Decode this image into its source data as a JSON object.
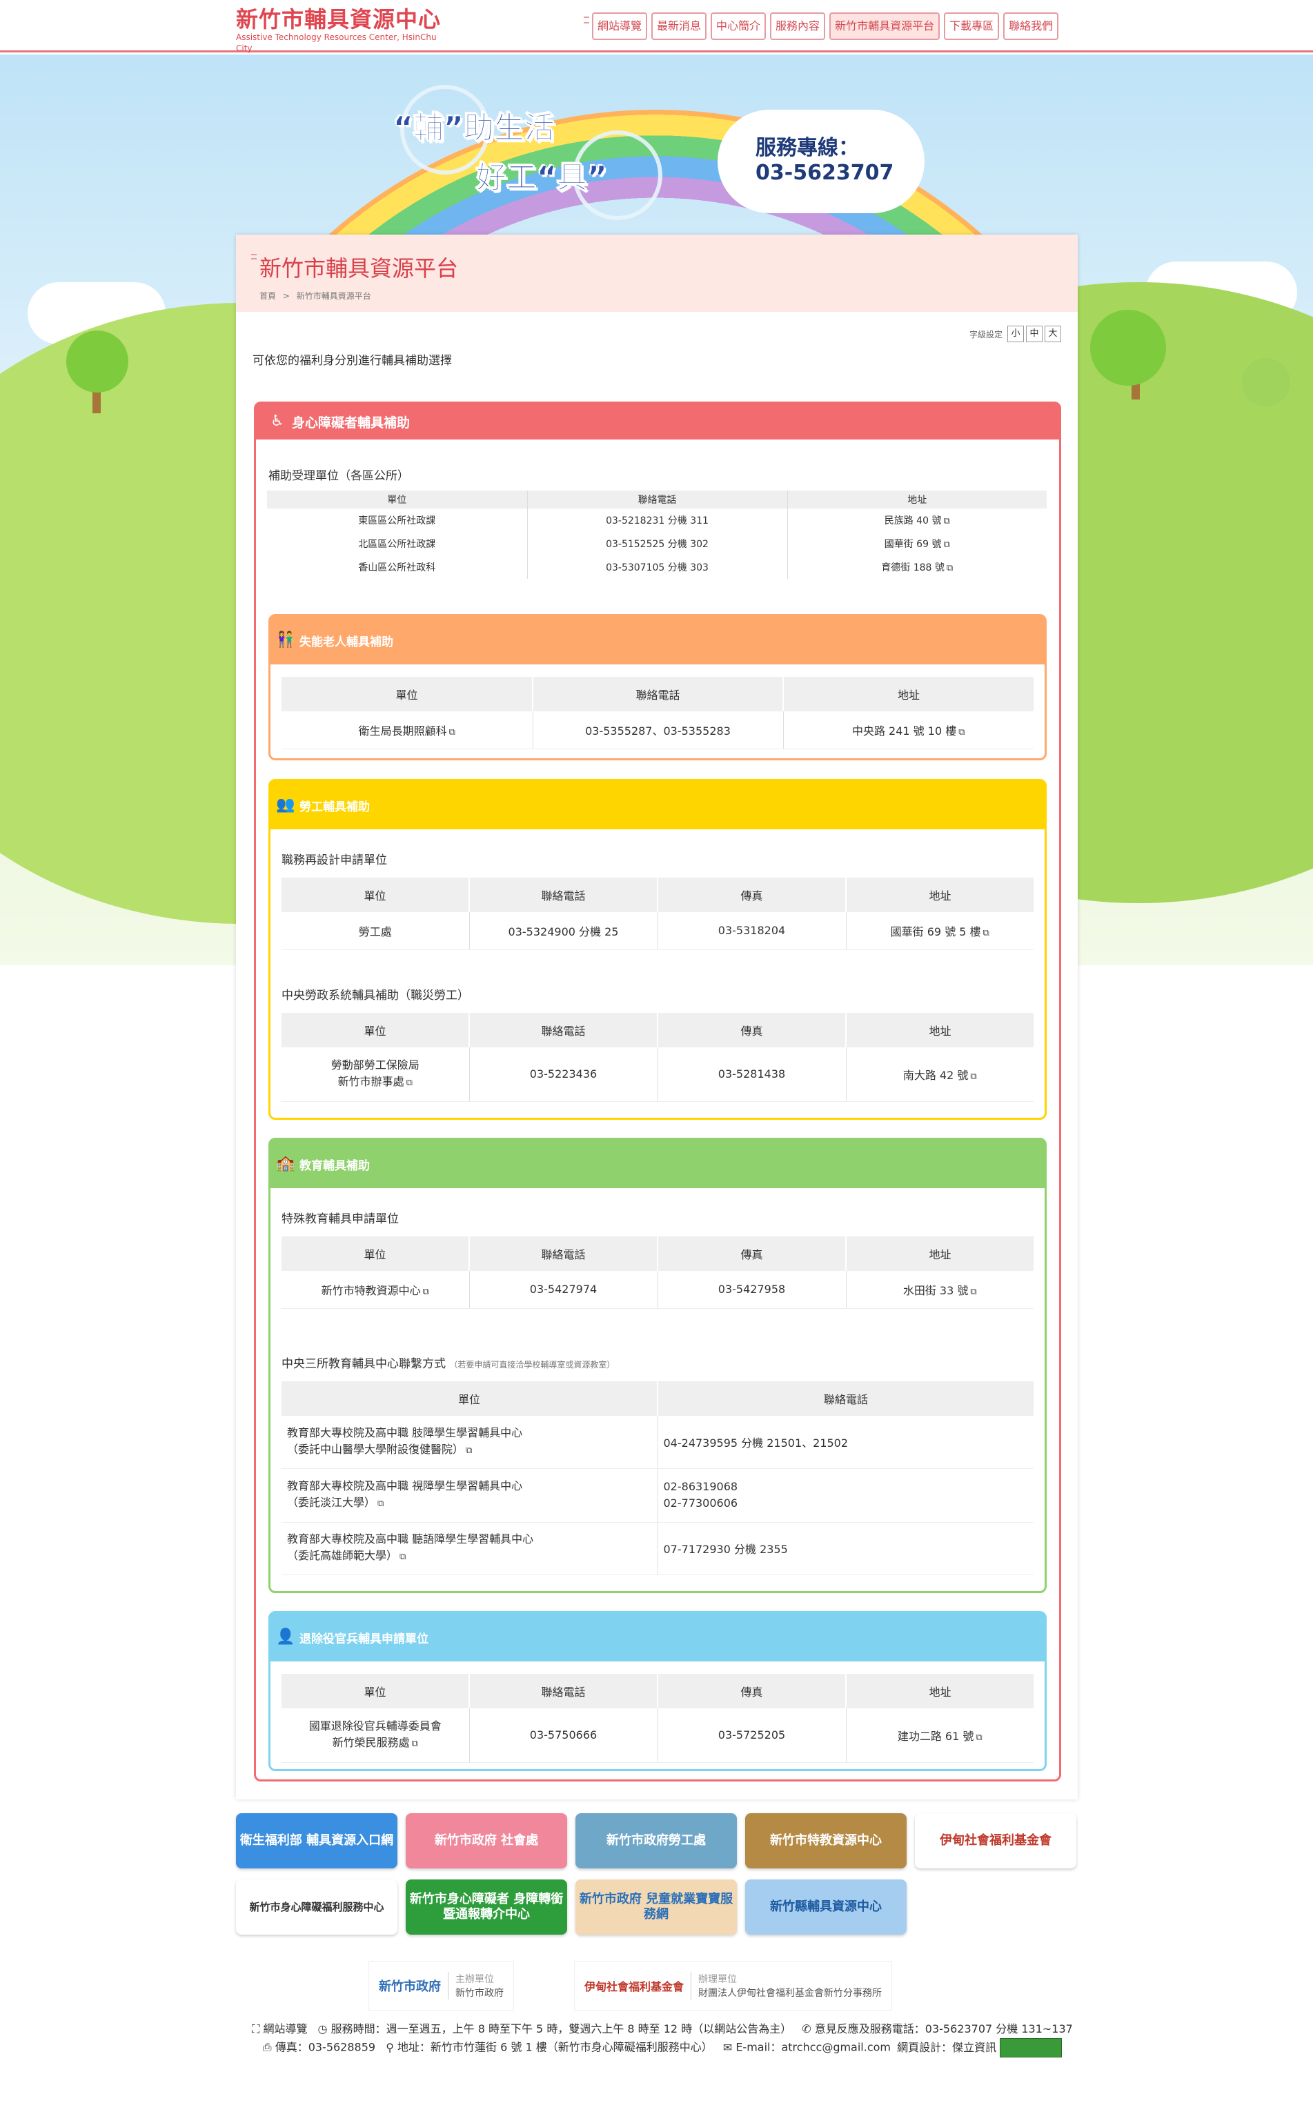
{
  "header": {
    "logo_title": "新竹市輔具資源中心",
    "logo_subtitle": "Assistive Technology Resources Center, HsinChu City",
    "nav": [
      "網站導覽",
      "最新消息",
      "中心簡介",
      "服務內容",
      "新竹市輔具資源平台",
      "下載專區",
      "聯絡我們"
    ]
  },
  "hero": {
    "slogan_line1": "“輔”助生活",
    "slogan_line2": "好工“具”",
    "hotline_label": "服務專線：",
    "hotline_number": "03-5623707"
  },
  "page": {
    "title": "新竹市輔具資源平台",
    "breadcrumb_home": "首頁",
    "breadcrumb_sep": ">",
    "breadcrumb_current": "新竹市輔具資源平台",
    "font_size_label": "字級設定",
    "font_sizes": [
      "小",
      "中",
      "大"
    ],
    "intro": "可依您的福利身分別進行輔具補助選擇"
  },
  "disabled": {
    "heading": "身心障礙者輔具補助",
    "sub_label": "補助受理單位（各區公所）",
    "columns": [
      "單位",
      "聯絡電話",
      "地址"
    ],
    "rows": [
      [
        "東區區公所社政課",
        "03-5218231 分機 311",
        "民族路 40 號"
      ],
      [
        "北區區公所社政課",
        "03-5152525 分機 302",
        "國華街 69 號"
      ],
      [
        "香山區公所社政科",
        "03-5307105 分機 303",
        "育德街 188 號"
      ]
    ]
  },
  "elderly": {
    "heading": "失能老人輔具補助",
    "columns": [
      "單位",
      "聯絡電話",
      "地址"
    ],
    "row": [
      "衛生局長期照顧科",
      "03-5355287、03-5355283",
      "中央路 241 號 10 樓"
    ]
  },
  "labor": {
    "heading": "勞工輔具補助",
    "sub1_label": "職務再設計申請單位",
    "columns": [
      "單位",
      "聯絡電話",
      "傳真",
      "地址"
    ],
    "sub1_row": [
      "勞工處",
      "03-5324900 分機 25",
      "03-5318204",
      "國華街 69 號 5 樓"
    ],
    "sub2_label": "中央勞政系統輔具補助（職災勞工）",
    "sub2_row_unit1": "勞動部勞工保險局",
    "sub2_row_unit2": "新竹市辦事處",
    "sub2_row": [
      "03-5223436",
      "03-5281438",
      "南大路 42 號"
    ]
  },
  "education": {
    "heading": "教育輔具補助",
    "sub1_label": "特殊教育輔具申請單位",
    "columns": [
      "單位",
      "聯絡電話",
      "傳真",
      "地址"
    ],
    "sub1_row": [
      "新竹市特教資源中心",
      "03-5427974",
      "03-5427958",
      "水田街 33 號"
    ],
    "sub2_label": "中央三所教育輔具中心聯繫方式",
    "sub2_note": "（若要申請可直接洽學校輔導室或資源教室）",
    "sub2_columns": [
      "單位",
      "聯絡電話"
    ],
    "sub2_rows": [
      {
        "unit1": "教育部大專校院及高中職 肢障學生學習輔具中心",
        "unit2": "（委託中山醫學大學附設復健醫院）",
        "phone1": "04-24739595 分機 21501、21502",
        "phone2": ""
      },
      {
        "unit1": "教育部大專校院及高中職 視障學生學習輔具中心",
        "unit2": "（委託淡江大學）",
        "phone1": "02-86319068",
        "phone2": "02-77300606"
      },
      {
        "unit1": "教育部大專校院及高中職 聽語障學生學習輔具中心",
        "unit2": "（委託高雄師範大學）",
        "phone1": "07-7172930 分機 2355",
        "phone2": ""
      }
    ]
  },
  "veteran": {
    "heading": "退除役官兵輔具申請單位",
    "columns": [
      "單位",
      "聯絡電話",
      "傳真",
      "地址"
    ],
    "unit1": "國軍退除役官兵輔導委員會",
    "unit2": "新竹榮民服務處",
    "row": [
      "03-5750666",
      "03-5725205",
      "建功二路 61 號"
    ]
  },
  "links": {
    "banners": [
      {
        "text": "衛生福利部 輔具資源入口網",
        "color": "#3a8fe0"
      },
      {
        "text": "新竹市政府 社會處",
        "color": "#f0879a"
      },
      {
        "text": "新竹市政府勞工處",
        "color": "#6fa7c9"
      },
      {
        "text": "新竹市特教資源中心",
        "color": "#b48a45"
      },
      {
        "text": "伊甸社會福利基金會",
        "color": "#ffffff"
      },
      {
        "text": "新竹市身心障礙福利服務中心",
        "color": "#ffffff"
      },
      {
        "text": "新竹市身心障礙者 身障轉銜暨通報轉介中心",
        "color": "#2e9e3d"
      },
      {
        "text": "新竹市政府 兒童就業寶寶服務網",
        "color": "#f3d9b3"
      },
      {
        "text": "新竹縣輔具資源中心",
        "color": "#a4cdf0"
      }
    ],
    "sponsor1_logo": "新竹市政府",
    "sponsor1_role": "主辦單位",
    "sponsor1_name": "新竹市政府",
    "sponsor2_logo": "伊甸社會福利基金會",
    "sponsor2_role": "辦理單位",
    "sponsor2_name": "財團法人伊甸社會福利基金會新竹分事務所"
  },
  "footer": {
    "sitemap": "網站導覽",
    "hours": "服務時間：週一至週五，上午 8 時至下午 5 時，雙週六上午 8 時至 12 時（以網站公告為主）",
    "feedback": "意見反應及服務電話：03-5623707 分機 131~137",
    "fax": "傳真：03-5628859",
    "address": "地址：新竹市竹蓮街 6 號 1 樓（新竹市身心障礙福利服務中心）",
    "email": "E-mail：atrchcc@gmail.com",
    "design": "網頁設計：傑立資訊"
  },
  "colors": {
    "disabled": "#f26b6f",
    "elderly": "#ffa86b",
    "labor": "#ffd500",
    "education": "#8fd16c",
    "veteran": "#7fd3f0"
  }
}
